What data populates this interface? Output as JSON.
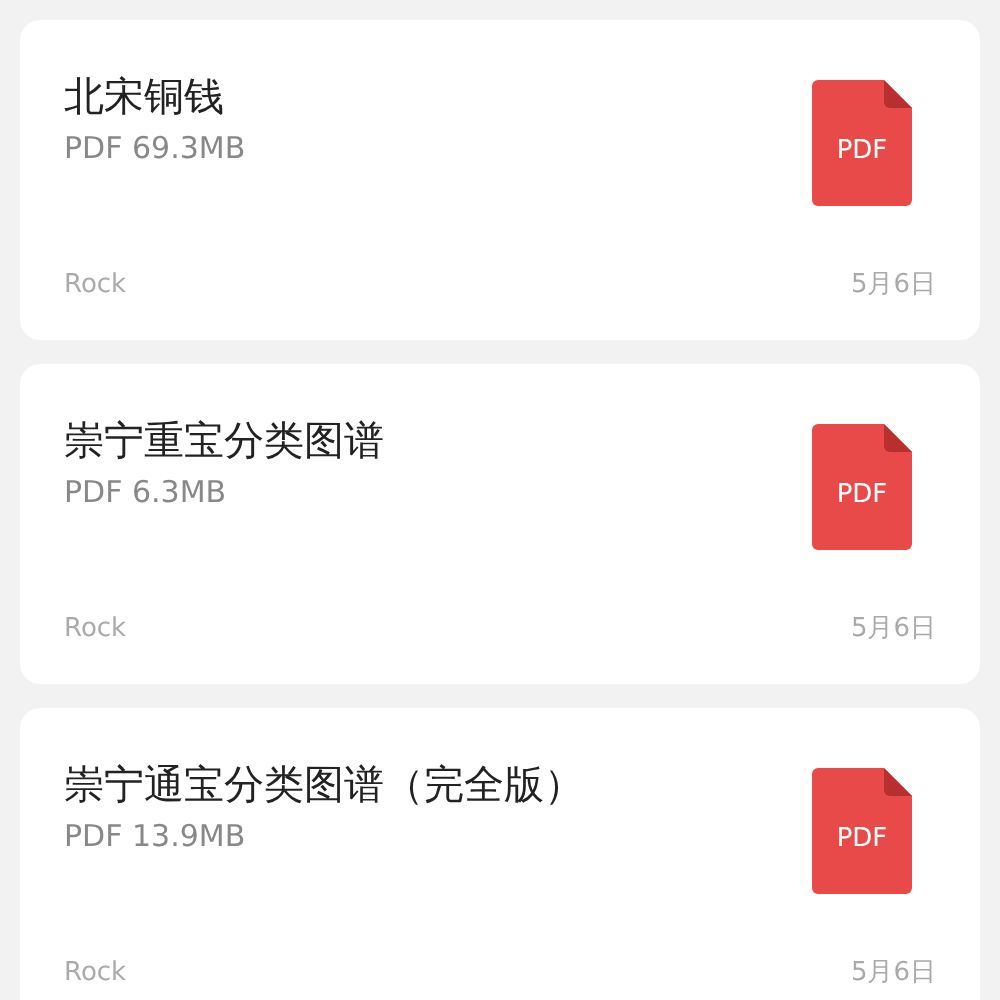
{
  "files": [
    {
      "title": "北宋铜钱",
      "info": "PDF 69.3MB",
      "icon_label": "PDF",
      "owner": "Rock",
      "date": "5月6日"
    },
    {
      "title": "崇宁重宝分类图谱",
      "info": "PDF 6.3MB",
      "icon_label": "PDF",
      "owner": "Rock",
      "date": "5月6日"
    },
    {
      "title": "崇宁通宝分类图谱（完全版）",
      "info": "PDF 13.9MB",
      "icon_label": "PDF",
      "owner": "Rock",
      "date": "5月6日"
    }
  ]
}
